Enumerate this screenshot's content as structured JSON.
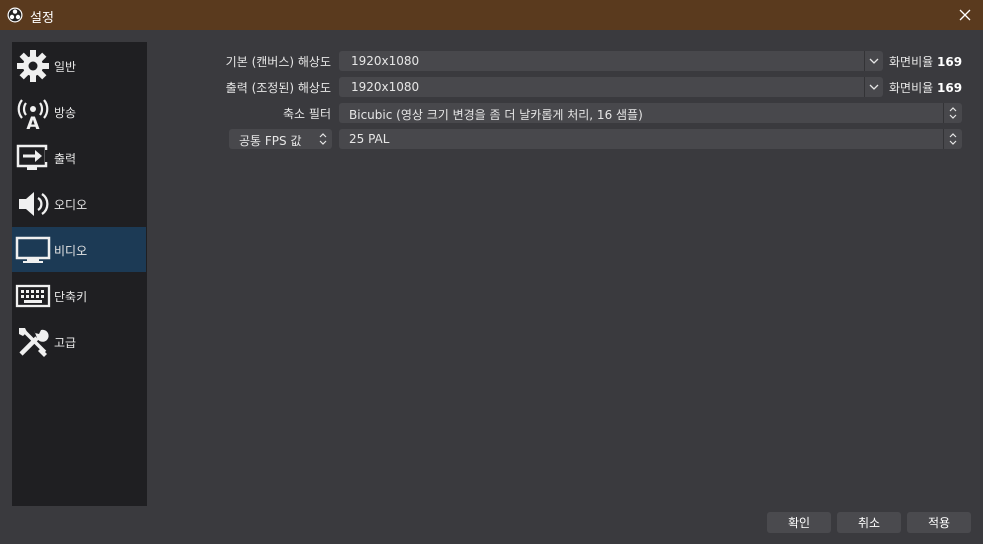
{
  "window": {
    "title": "설정",
    "titlebar_color": "#5a3a1e"
  },
  "sidebar": {
    "items": [
      {
        "label": "일반",
        "icon": "gear-icon"
      },
      {
        "label": "방송",
        "icon": "broadcast-antenna-icon"
      },
      {
        "label": "출력",
        "icon": "output-arrow-icon"
      },
      {
        "label": "오디오",
        "icon": "speaker-icon"
      },
      {
        "label": "비디오",
        "icon": "monitor-icon"
      },
      {
        "label": "단축키",
        "icon": "keyboard-icon"
      },
      {
        "label": "고급",
        "icon": "tools-icon"
      }
    ],
    "active_index": 4,
    "active_color": "#1c3a55"
  },
  "video": {
    "base_resolution": {
      "label": "기본 (캔버스) 해상도",
      "value": "1920x1080",
      "ratio_label": "화면비율",
      "ratio_value": "169"
    },
    "output_resolution": {
      "label": "출력 (조정된) 해상도",
      "value": "1920x1080",
      "ratio_label": "화면비율",
      "ratio_value": "169"
    },
    "downscale_filter": {
      "label": "축소 필터",
      "value": "Bicubic (영상 크기 변경을 좀 더 날카롭게 처리, 16 샘플)"
    },
    "fps": {
      "type_label": "공통 FPS 값",
      "value": "25 PAL"
    }
  },
  "footer": {
    "ok_label": "확인",
    "cancel_label": "취소",
    "apply_label": "적용"
  }
}
